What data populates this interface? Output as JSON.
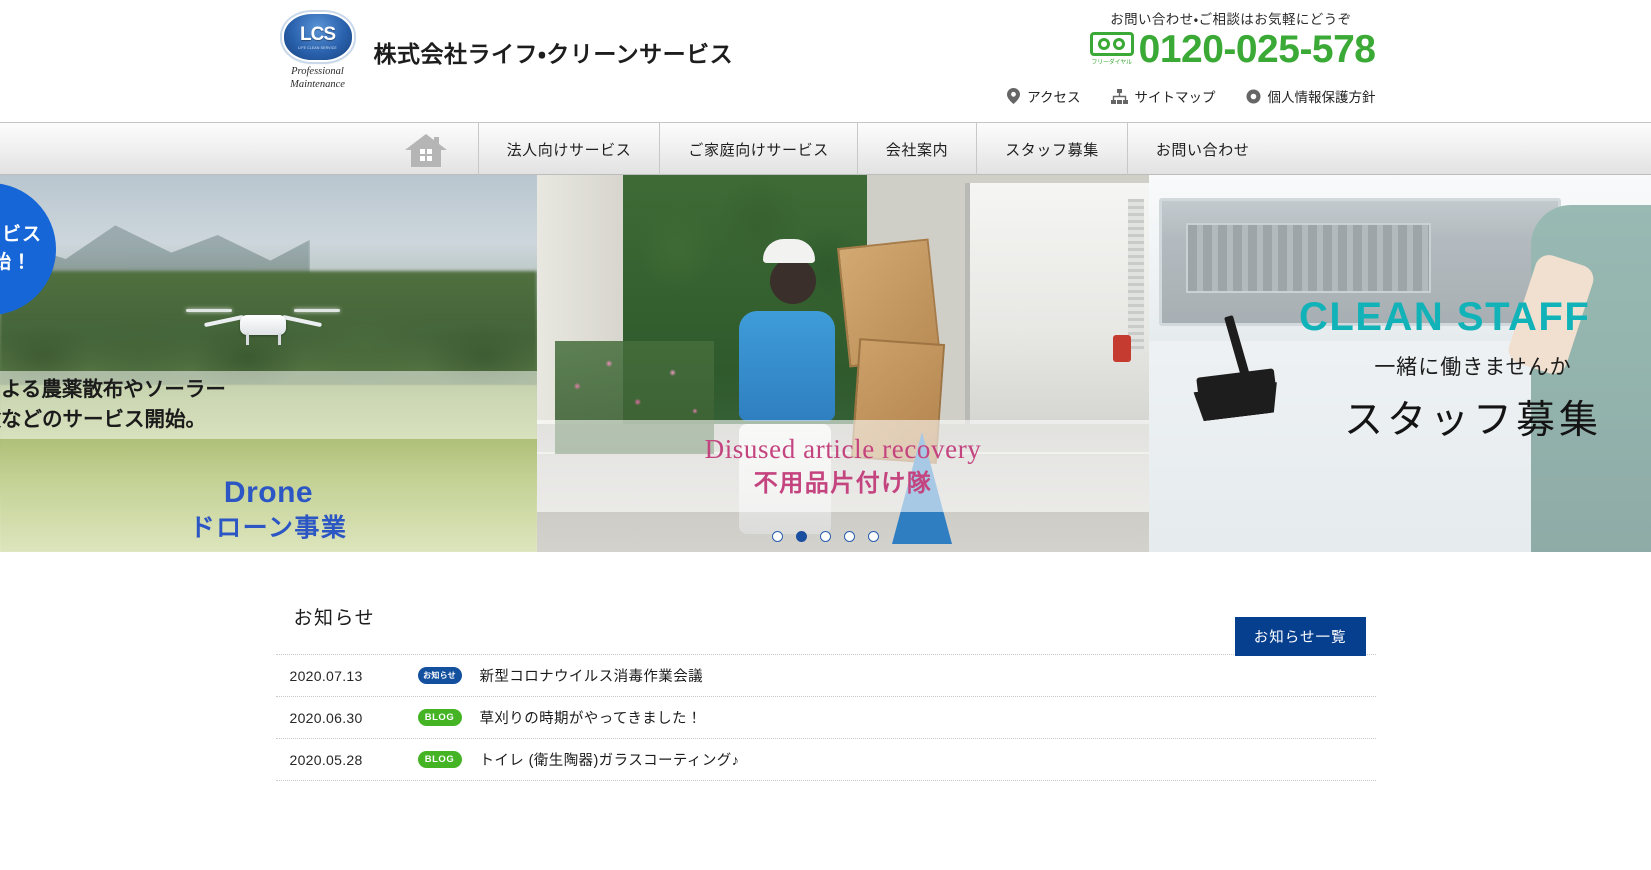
{
  "header": {
    "logo": {
      "letters": "LCS",
      "logo_subtext": "LIFE CLEAN SERVICE",
      "tagline_line1": "Professional",
      "tagline_line2": "Maintenance"
    },
    "company_name": "株式会社ライフ・クリーンサービス",
    "contact_lead": "お問い合わせ・ご相談はお気軽にどうぞ",
    "freedial_label": "フリーダイヤル",
    "phone": "0120-025-578",
    "phone_color": "#3aa935",
    "util_links": [
      {
        "label": "アクセス",
        "icon": "location-pin-icon"
      },
      {
        "label": "サイトマップ",
        "icon": "sitemap-icon"
      },
      {
        "label": "個人情報保護方針",
        "icon": "circle-icon"
      }
    ]
  },
  "nav": {
    "home_icon": "home-icon",
    "items": [
      {
        "label": "法人向けサービス"
      },
      {
        "label": "ご家庭向けサービス"
      },
      {
        "label": "会社案内"
      },
      {
        "label": "スタッフ募集"
      },
      {
        "label": "お問い合わせ"
      }
    ]
  },
  "carousel": {
    "slides": [
      {
        "name": "drone-slide",
        "badge_line1": "ービス",
        "badge_line2": "始！",
        "strip_line1": "ンによる農薬散布やソーラー",
        "strip_line2": "点検などのサービス開始。",
        "caption_en": "Drone",
        "caption_jp": "ドローン事業",
        "caption_color": "#2b56c4"
      },
      {
        "name": "disused-article-recovery-slide",
        "caption_en": "Disused article recovery",
        "caption_jp": "不用品片付け隊",
        "caption_color": "#c4447f"
      },
      {
        "name": "clean-staff-slide",
        "caption_en": "CLEAN STAFF",
        "caption_sub": "一緒に働きませんか",
        "caption_jp": "スタッフ募集",
        "caption_color": "#12b3b8"
      }
    ],
    "dots": [
      {
        "active": false
      },
      {
        "active": true
      },
      {
        "active": false
      },
      {
        "active": false
      },
      {
        "active": false
      }
    ]
  },
  "news": {
    "title": "お知らせ",
    "all_button_label": "お知らせ一覧",
    "all_button_color": "#073f8f",
    "items": [
      {
        "date": "2020.07.13",
        "badge": "お知らせ",
        "badge_color": "#13509e",
        "text": "新型コロナウイルス消毒作業会議"
      },
      {
        "date": "2020.06.30",
        "badge": "BLOG",
        "badge_color": "#44b324",
        "text": "草刈りの時期がやってきました！"
      },
      {
        "date": "2020.05.28",
        "badge": "BLOG",
        "badge_color": "#44b324",
        "text": "トイレ (衛生陶器)ガラスコーティング♪"
      }
    ]
  }
}
